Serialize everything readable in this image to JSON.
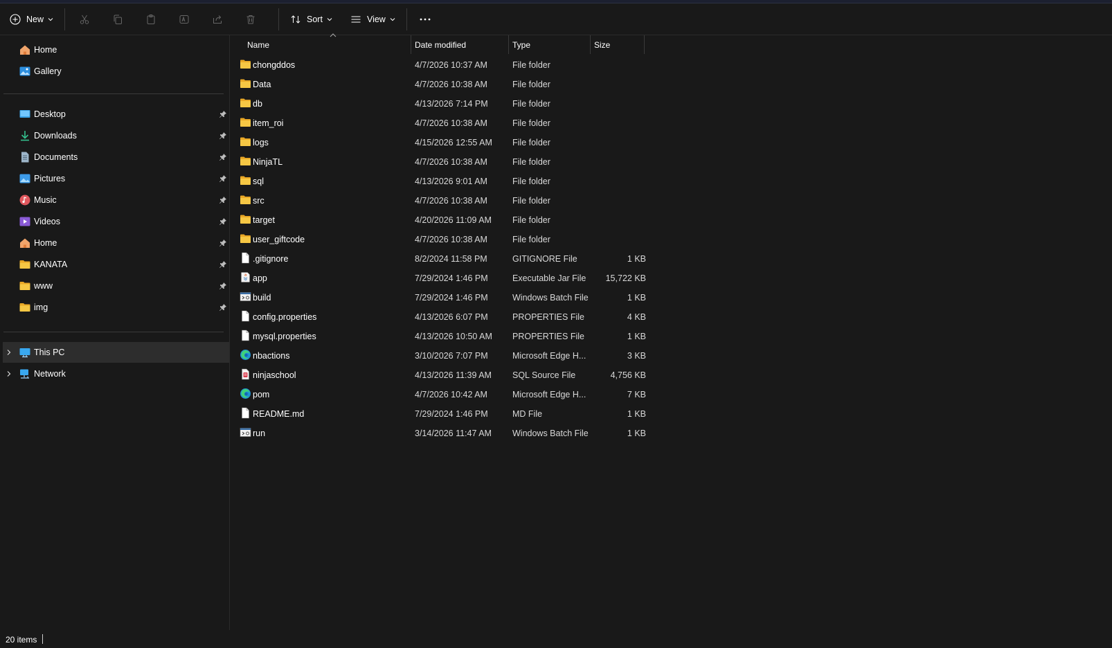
{
  "toolbar": {
    "new_label": "New",
    "sort_label": "Sort",
    "view_label": "View"
  },
  "sidebar": {
    "quick": [
      {
        "label": "Home",
        "icon": "home-icon"
      },
      {
        "label": "Gallery",
        "icon": "gallery-icon"
      }
    ],
    "pinned": [
      {
        "label": "Desktop",
        "icon": "desktop-icon"
      },
      {
        "label": "Downloads",
        "icon": "downloads-icon"
      },
      {
        "label": "Documents",
        "icon": "documents-icon"
      },
      {
        "label": "Pictures",
        "icon": "pictures-icon"
      },
      {
        "label": "Music",
        "icon": "music-icon"
      },
      {
        "label": "Videos",
        "icon": "videos-icon"
      },
      {
        "label": "Home",
        "icon": "home-icon"
      },
      {
        "label": "KANATA",
        "icon": "folder-icon"
      },
      {
        "label": "www",
        "icon": "folder-icon"
      },
      {
        "label": "img",
        "icon": "folder-icon"
      }
    ],
    "locations": [
      {
        "label": "This PC",
        "icon": "this-pc-icon",
        "selected": true
      },
      {
        "label": "Network",
        "icon": "network-icon",
        "selected": false
      }
    ]
  },
  "columns": {
    "name": "Name",
    "date": "Date modified",
    "type": "Type",
    "size": "Size"
  },
  "files": [
    {
      "name": "chongddos",
      "date": "4/7/2026 10:37 AM",
      "type": "File folder",
      "size": "",
      "icon": "folder-icon"
    },
    {
      "name": "Data",
      "date": "4/7/2026 10:38 AM",
      "type": "File folder",
      "size": "",
      "icon": "folder-icon"
    },
    {
      "name": "db",
      "date": "4/13/2026 7:14 PM",
      "type": "File folder",
      "size": "",
      "icon": "folder-icon"
    },
    {
      "name": "item_roi",
      "date": "4/7/2026 10:38 AM",
      "type": "File folder",
      "size": "",
      "icon": "folder-icon"
    },
    {
      "name": "logs",
      "date": "4/15/2026 12:55 AM",
      "type": "File folder",
      "size": "",
      "icon": "folder-icon"
    },
    {
      "name": "NinjaTL",
      "date": "4/7/2026 10:38 AM",
      "type": "File folder",
      "size": "",
      "icon": "folder-icon"
    },
    {
      "name": "sql",
      "date": "4/13/2026 9:01 AM",
      "type": "File folder",
      "size": "",
      "icon": "folder-icon"
    },
    {
      "name": "src",
      "date": "4/7/2026 10:38 AM",
      "type": "File folder",
      "size": "",
      "icon": "folder-icon"
    },
    {
      "name": "target",
      "date": "4/20/2026 11:09 AM",
      "type": "File folder",
      "size": "",
      "icon": "folder-icon"
    },
    {
      "name": "user_giftcode",
      "date": "4/7/2026 10:38 AM",
      "type": "File folder",
      "size": "",
      "icon": "folder-icon"
    },
    {
      "name": ".gitignore",
      "date": "8/2/2024 11:58 PM",
      "type": "GITIGNORE File",
      "size": "1 KB",
      "icon": "file-icon"
    },
    {
      "name": "app",
      "date": "7/29/2024 1:46 PM",
      "type": "Executable Jar File",
      "size": "15,722 KB",
      "icon": "jar-icon"
    },
    {
      "name": "build",
      "date": "7/29/2024 1:46 PM",
      "type": "Windows Batch File",
      "size": "1 KB",
      "icon": "batch-icon"
    },
    {
      "name": "config.properties",
      "date": "4/13/2026 6:07 PM",
      "type": "PROPERTIES File",
      "size": "4 KB",
      "icon": "file-icon"
    },
    {
      "name": "mysql.properties",
      "date": "4/13/2026 10:50 AM",
      "type": "PROPERTIES File",
      "size": "1 KB",
      "icon": "file-icon"
    },
    {
      "name": "nbactions",
      "date": "3/10/2026 7:07 PM",
      "type": "Microsoft Edge H...",
      "size": "3 KB",
      "icon": "edge-icon"
    },
    {
      "name": "ninjaschool",
      "date": "4/13/2026 11:39 AM",
      "type": "SQL Source File",
      "size": "4,756 KB",
      "icon": "sql-file-icon"
    },
    {
      "name": "pom",
      "date": "4/7/2026 10:42 AM",
      "type": "Microsoft Edge H...",
      "size": "7 KB",
      "icon": "edge-icon"
    },
    {
      "name": "README.md",
      "date": "7/29/2024 1:46 PM",
      "type": "MD File",
      "size": "1 KB",
      "icon": "file-icon"
    },
    {
      "name": "run",
      "date": "3/14/2026 11:47 AM",
      "type": "Windows Batch File",
      "size": "1 KB",
      "icon": "batch-icon"
    }
  ],
  "status": {
    "item_count": "20 items"
  },
  "colors": {
    "background": "#191919",
    "folder": "#f6c744",
    "selected": "#2d2d2d"
  }
}
